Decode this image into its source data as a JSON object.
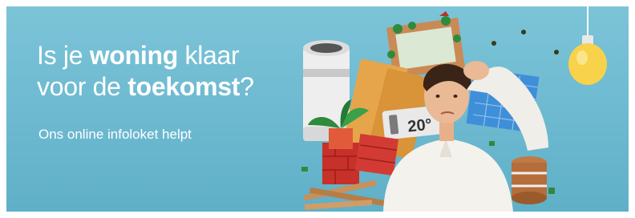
{
  "banner": {
    "headline": {
      "line1_prefix": "Is je ",
      "line1_bold": "woning",
      "line1_suffix": " klaar",
      "line2_prefix": "voor de ",
      "line2_bold": "toekomst",
      "line2_suffix": "?"
    },
    "subline": "Ons online infoloket helpt",
    "thermostat_reading": "20°"
  },
  "colors": {
    "background": "#6bb8cf",
    "text": "#ffffff",
    "insulation": "#e6a54a",
    "solar_panel": "#3f8fd8",
    "brick": "#c8302a",
    "bulb": "#f7d24a"
  }
}
